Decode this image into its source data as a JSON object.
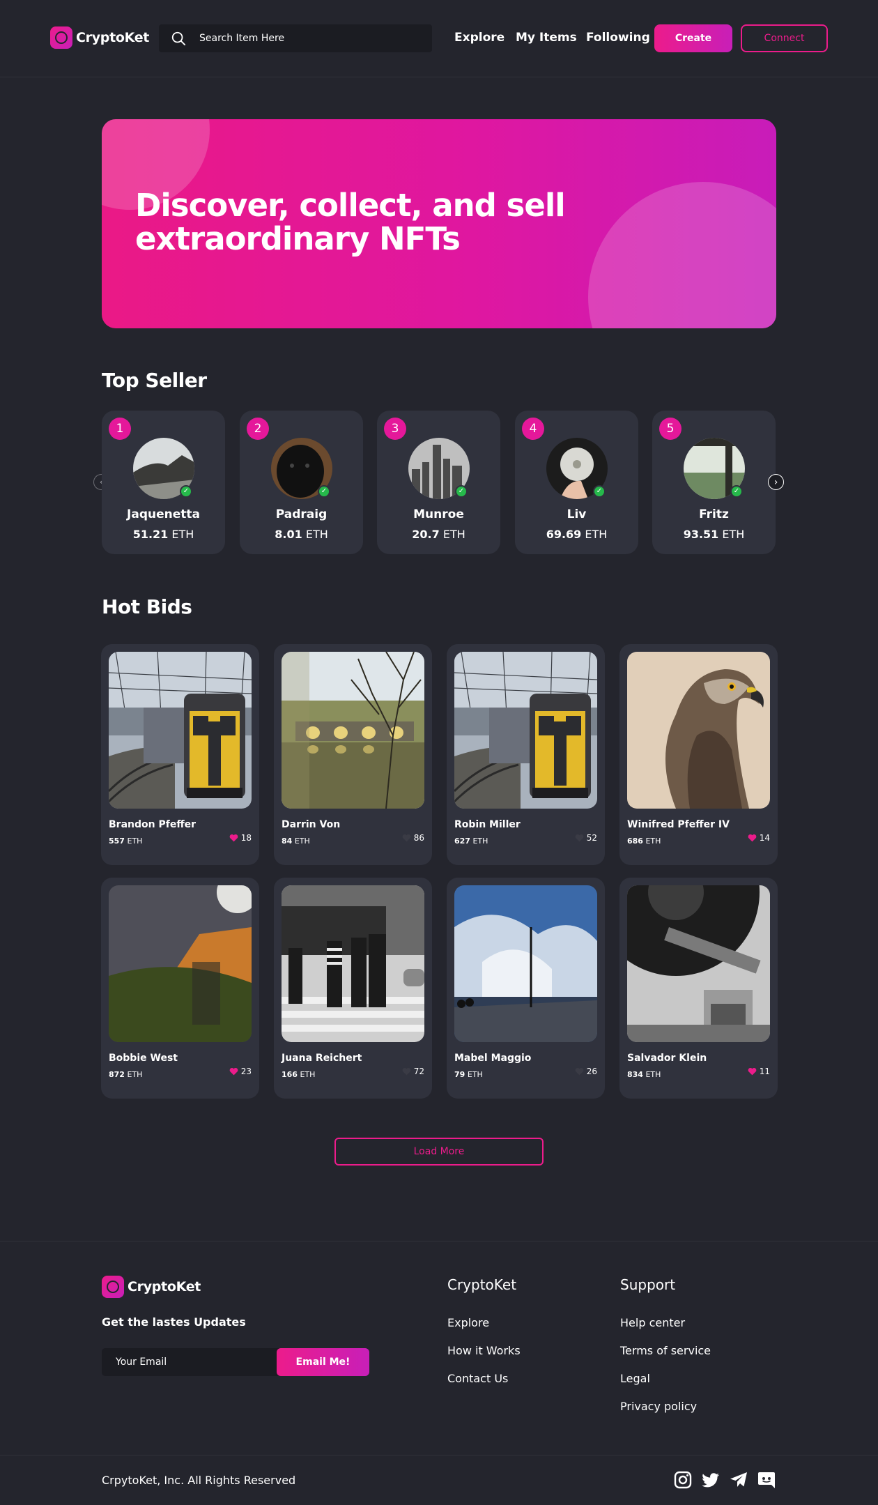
{
  "brand": {
    "name": "CryptoKet",
    "accent": "#ec1c8b",
    "accent_end": "#c81fb8",
    "background": "#24252d",
    "card": "#30323d"
  },
  "nav": {
    "search_placeholder": "Search Item Here",
    "links": [
      "Explore",
      "My Items",
      "Following"
    ],
    "create_label": "Create",
    "connect_label": "Connect"
  },
  "hero": {
    "title": "Discover, collect, and sell extraordinary NFTs"
  },
  "top_sellers": {
    "title": "Top Seller",
    "sellers": [
      {
        "rank": "1",
        "name": "Jaquenetta",
        "amount": "51.21",
        "unit": "ETH",
        "verified_icon": "check-icon"
      },
      {
        "rank": "2",
        "name": "Padraig",
        "amount": "8.01",
        "unit": "ETH",
        "verified_icon": "check-icon"
      },
      {
        "rank": "3",
        "name": "Munroe",
        "amount": "20.7",
        "unit": "ETH",
        "verified_icon": "check-icon"
      },
      {
        "rank": "4",
        "name": "Liv",
        "amount": "69.69",
        "unit": "ETH",
        "verified_icon": "check-icon"
      },
      {
        "rank": "5",
        "name": "Fritz",
        "amount": "93.51",
        "unit": "ETH",
        "verified_icon": "check-icon"
      }
    ],
    "prev_icon": "chevron-left-icon",
    "next_icon": "chevron-right-icon"
  },
  "hot_bids": {
    "title": "Hot Bids",
    "items": [
      {
        "name": "Brandon Pfeffer",
        "price": "557",
        "unit": "ETH",
        "likes": "18",
        "liked": true,
        "image": "train"
      },
      {
        "name": "Darrin Von",
        "price": "84",
        "unit": "ETH",
        "likes": "86",
        "liked": false,
        "image": "river-bridge"
      },
      {
        "name": "Robin Miller",
        "price": "627",
        "unit": "ETH",
        "likes": "52",
        "liked": false,
        "image": "train"
      },
      {
        "name": "Winifred Pfeffer IV",
        "price": "686",
        "unit": "ETH",
        "likes": "14",
        "liked": true,
        "image": "hawk"
      },
      {
        "name": "Bobbie West",
        "price": "872",
        "unit": "ETH",
        "likes": "23",
        "liked": true,
        "image": "night-field"
      },
      {
        "name": "Juana Reichert",
        "price": "166",
        "unit": "ETH",
        "likes": "72",
        "liked": false,
        "image": "crosswalk"
      },
      {
        "name": "Mabel Maggio",
        "price": "79",
        "unit": "ETH",
        "likes": "26",
        "liked": false,
        "image": "seaside-sky"
      },
      {
        "name": "Salvador Klein",
        "price": "834",
        "unit": "ETH",
        "likes": "11",
        "liked": true,
        "image": "turntable"
      }
    ],
    "load_more_label": "Load More"
  },
  "footer": {
    "brand": "CryptoKet",
    "updates_heading": "Get the lastes Updates",
    "email_placeholder": "Your Email",
    "email_button": "Email Me!",
    "columns": [
      {
        "title": "CryptoKet",
        "links": [
          "Explore",
          "How it Works",
          "Contact Us"
        ]
      },
      {
        "title": "Support",
        "links": [
          "Help center",
          "Terms of service",
          "Legal",
          "Privacy policy"
        ]
      }
    ],
    "copyright": "CrpytoKet, Inc. All Rights Reserved",
    "social_icons": [
      "instagram-icon",
      "twitter-icon",
      "telegram-icon",
      "discord-icon"
    ]
  }
}
